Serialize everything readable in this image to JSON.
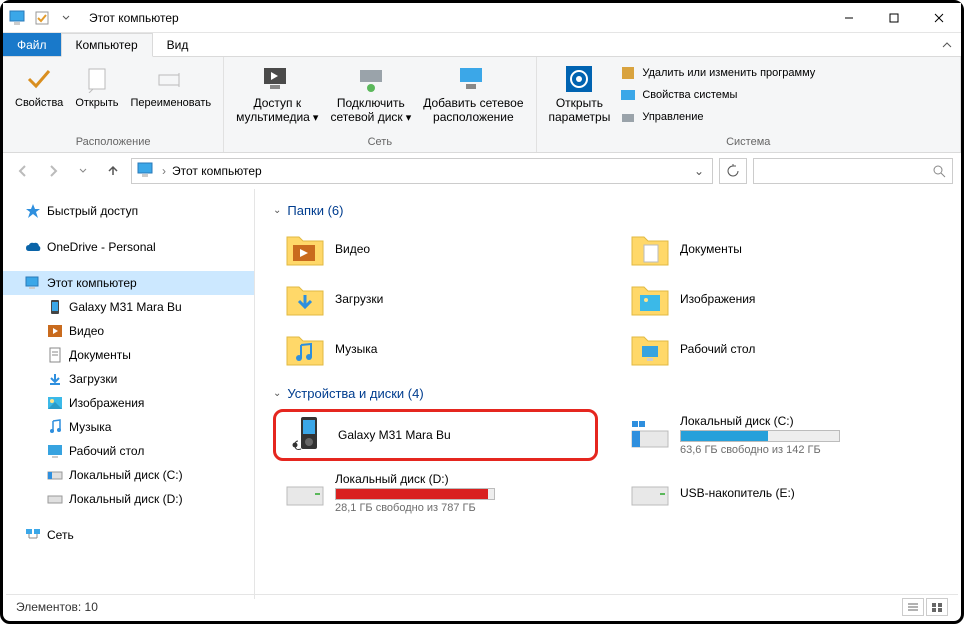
{
  "window_title": "Этот компьютер",
  "tabs": {
    "file": "Файл",
    "computer": "Компьютер",
    "view": "Вид"
  },
  "ribbon": {
    "group_location": "Расположение",
    "group_network": "Сеть",
    "group_system": "Система",
    "properties": "Свойства",
    "open": "Открыть",
    "rename": "Переименовать",
    "media_access_l1": "Доступ к",
    "media_access_l2": "мультимедиа",
    "map_drive_l1": "Подключить",
    "map_drive_l2": "сетевой диск",
    "add_netloc_l1": "Добавить сетевое",
    "add_netloc_l2": "расположение",
    "open_settings_l1": "Открыть",
    "open_settings_l2": "параметры",
    "uninstall": "Удалить или изменить программу",
    "sys_props": "Свойства системы",
    "manage": "Управление"
  },
  "breadcrumb": {
    "root": "Этот компьютер"
  },
  "nav": {
    "quick": "Быстрый доступ",
    "onedrive": "OneDrive - Personal",
    "thispc": "Этот компьютер",
    "galaxy": "Galaxy M31 Mara Bu",
    "videos": "Видео",
    "documents": "Документы",
    "downloads": "Загрузки",
    "pictures": "Изображения",
    "music": "Музыка",
    "desktop": "Рабочий стол",
    "disk_c": "Локальный диск (C:)",
    "disk_d": "Локальный диск (D:)",
    "network": "Сеть"
  },
  "content": {
    "folders_header": "Папки (6)",
    "devices_header": "Устройства и диски (4)",
    "folders": {
      "videos": "Видео",
      "documents": "Документы",
      "downloads": "Загрузки",
      "pictures": "Изображения",
      "music": "Музыка",
      "desktop": "Рабочий стол"
    },
    "drives": {
      "galaxy": "Galaxy M31 Mara Bu",
      "disk_c": "Локальный диск (C:)",
      "disk_c_free": "63,6 ГБ свободно из 142 ГБ",
      "disk_d": "Локальный диск (D:)",
      "disk_d_free": "28,1 ГБ свободно из 787 ГБ",
      "usb": "USB-накопитель (E:)"
    }
  },
  "status": {
    "elements": "Элементов: 10"
  },
  "colors": {
    "bar_blue": "#26a0da",
    "bar_red": "#d9201f"
  }
}
